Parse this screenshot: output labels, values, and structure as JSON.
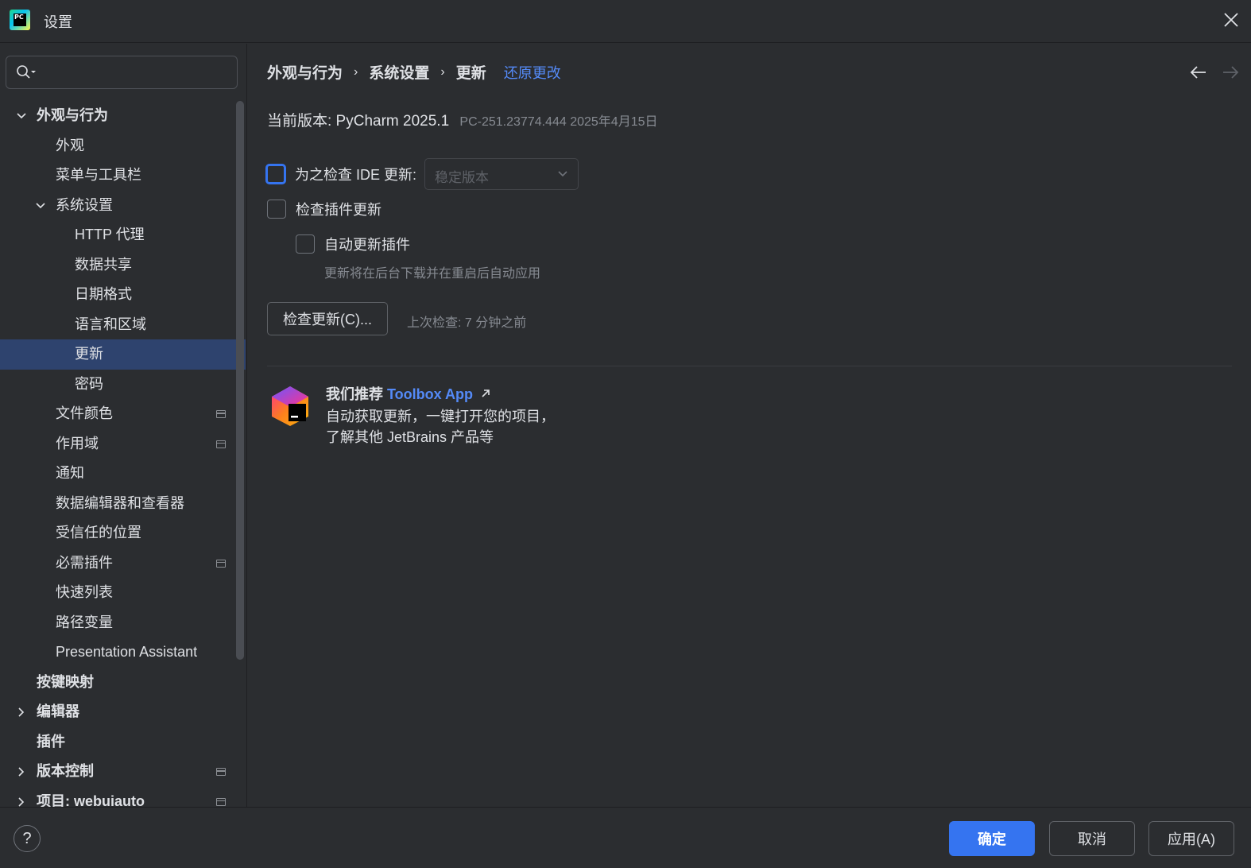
{
  "window": {
    "title": "设置",
    "logo_text": "PC"
  },
  "sidebar": {
    "search": {
      "value": "",
      "placeholder": ""
    },
    "items": [
      {
        "label": "外观与行为",
        "level": 0,
        "bold": true,
        "chevron": "down"
      },
      {
        "label": "外观",
        "level": 1
      },
      {
        "label": "菜单与工具栏",
        "level": 1
      },
      {
        "label": "系统设置",
        "level": 1,
        "chevron": "down"
      },
      {
        "label": "HTTP 代理",
        "level": 2
      },
      {
        "label": "数据共享",
        "level": 2
      },
      {
        "label": "日期格式",
        "level": 2
      },
      {
        "label": "语言和区域",
        "level": 2
      },
      {
        "label": "更新",
        "level": 2,
        "selected": true
      },
      {
        "label": "密码",
        "level": 2
      },
      {
        "label": "文件颜色",
        "level": 1,
        "pin": true
      },
      {
        "label": "作用域",
        "level": 1,
        "pin": true
      },
      {
        "label": "通知",
        "level": 1
      },
      {
        "label": "数据编辑器和查看器",
        "level": 1
      },
      {
        "label": "受信任的位置",
        "level": 1
      },
      {
        "label": "必需插件",
        "level": 1,
        "pin": true
      },
      {
        "label": "快速列表",
        "level": 1
      },
      {
        "label": "路径变量",
        "level": 1
      },
      {
        "label": "Presentation Assistant",
        "level": 1
      },
      {
        "label": "按键映射",
        "level": 0,
        "bold": true
      },
      {
        "label": "编辑器",
        "level": 0,
        "bold": true,
        "chevron": "right"
      },
      {
        "label": "插件",
        "level": 0,
        "bold": true
      },
      {
        "label": "版本控制",
        "level": 0,
        "bold": true,
        "chevron": "right",
        "pin": true
      },
      {
        "label": "项目: webuiauto",
        "level": 0,
        "bold": true,
        "chevron": "right",
        "pin": true
      }
    ]
  },
  "main": {
    "breadcrumb": [
      "外观与行为",
      "系统设置",
      "更新"
    ],
    "reset_label": "还原更改",
    "version_label": "当前版本: PyCharm 2025.1",
    "build_info": "PC-251.23774.444 2025年4月15日",
    "ide_update_label": "为之检查 IDE 更新:",
    "ide_update_checked": false,
    "channel_value": "稳定版本",
    "plugin_update_label": "检查插件更新",
    "plugin_update_checked": false,
    "auto_update_label": "自动更新插件",
    "auto_update_checked": false,
    "auto_update_hint": "更新将在后台下载并在重启后自动应用",
    "check_button": "检查更新(C)...",
    "last_check": "上次检查: 7 分钟之前",
    "toolbox": {
      "title_prefix": "我们推荐 ",
      "title_link": "Toolbox App",
      "line1": "自动获取更新，一键打开您的项目，",
      "line2": "了解其他 JetBrains 产品等"
    }
  },
  "footer": {
    "help": "?",
    "ok": "确定",
    "cancel": "取消",
    "apply": "应用(A)"
  },
  "colors": {
    "background": "#2b2d30",
    "accent": "#3574f0",
    "link": "#548af7",
    "selection": "#2e436e",
    "muted_text": "#868a91"
  }
}
